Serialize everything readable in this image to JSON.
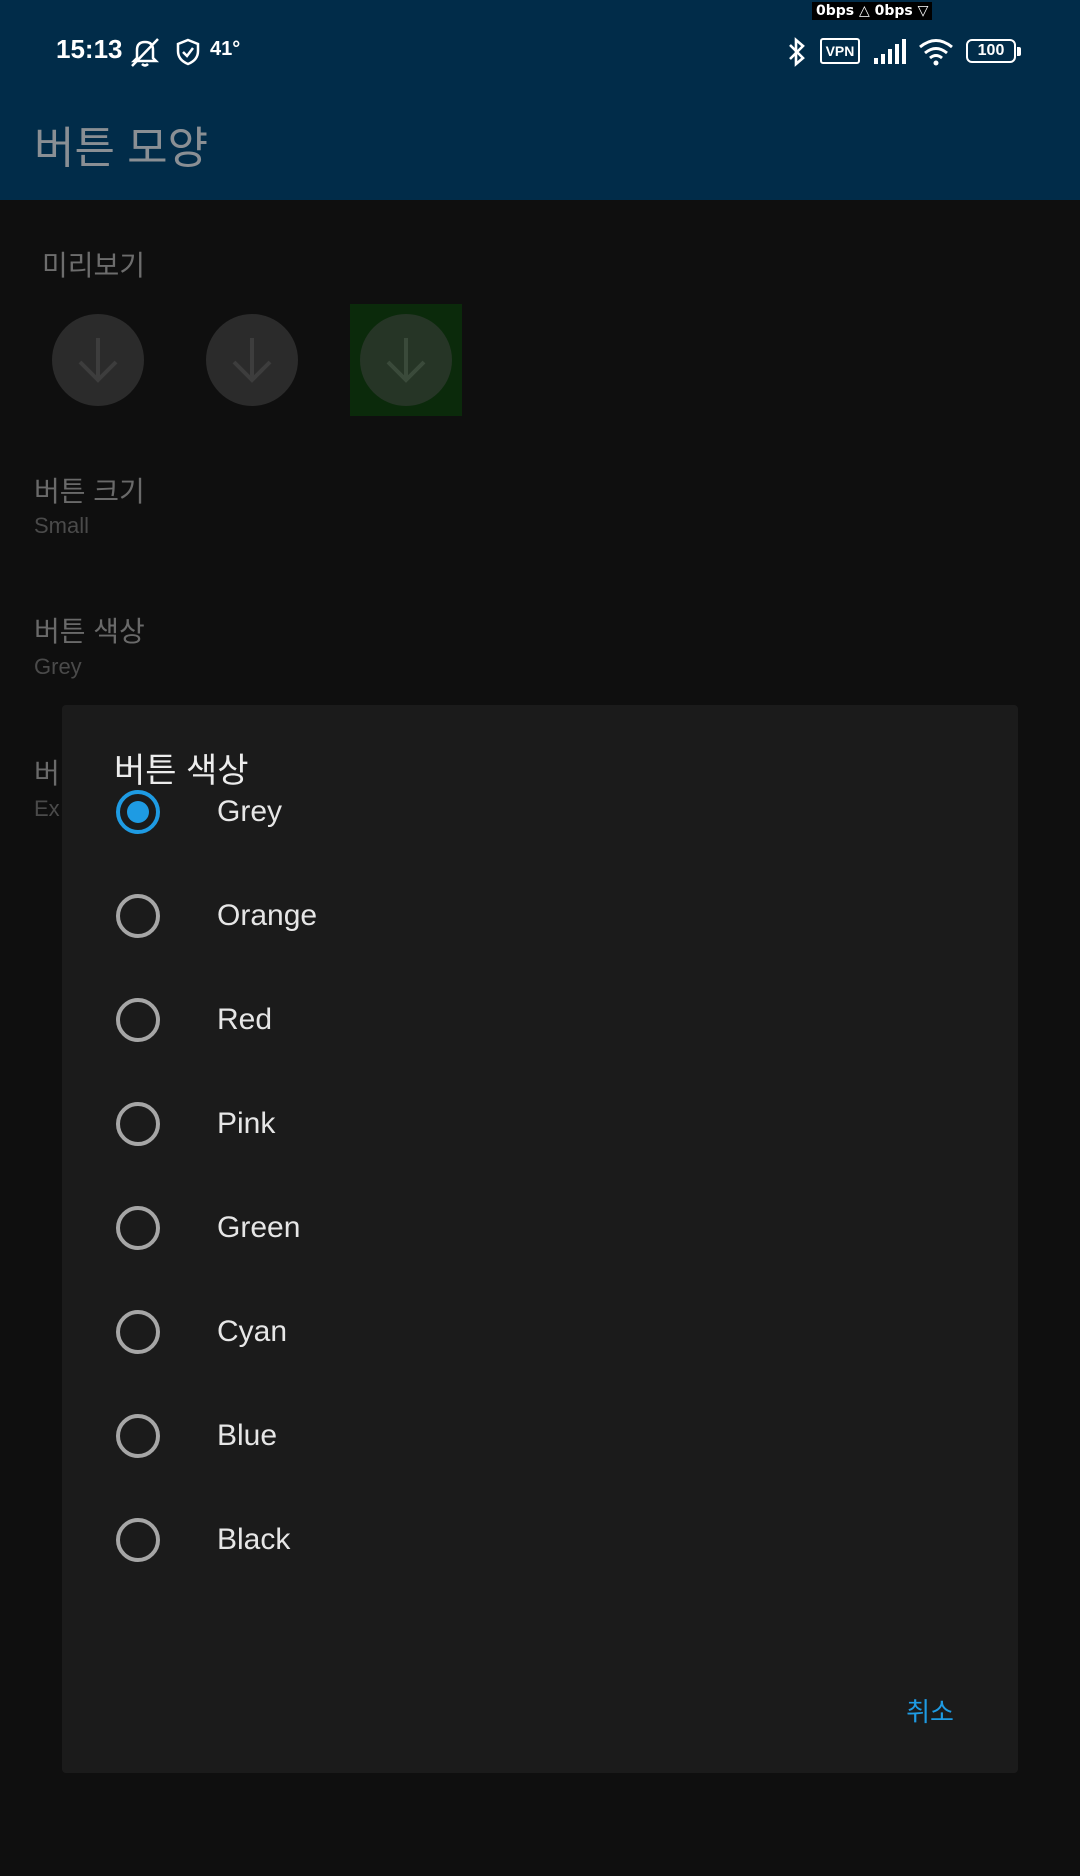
{
  "status_bar": {
    "net_speed": "0bps △ 0bps ▽",
    "time": "15:13",
    "temperature": "41°",
    "vpn_label": "VPN",
    "battery": "100"
  },
  "app_bar": {
    "title": "버튼 모양"
  },
  "background_page": {
    "preview_label": "미리보기",
    "preview_buttons": [
      "download-icon",
      "download-icon",
      "download-icon"
    ],
    "button_size": {
      "title": "버튼 크기",
      "summary": "Small"
    },
    "button_color": {
      "title": "버튼 색상",
      "summary": "Grey"
    },
    "third_pref": {
      "title": "버",
      "summary": "Ex"
    }
  },
  "dialog": {
    "title": "버튼 색상",
    "options": [
      {
        "label": "Grey",
        "checked": true
      },
      {
        "label": "Orange",
        "checked": false
      },
      {
        "label": "Red",
        "checked": false
      },
      {
        "label": "Pink",
        "checked": false
      },
      {
        "label": "Green",
        "checked": false
      },
      {
        "label": "Cyan",
        "checked": false
      },
      {
        "label": "Blue",
        "checked": false
      },
      {
        "label": "Black",
        "checked": false
      }
    ],
    "cancel_label": "취소"
  },
  "colors": {
    "accent": "#1e9be3",
    "app_bar": "#012c49",
    "dialog_bg": "#1b1b1b",
    "selected_preview_bg": "#0b2a0b"
  }
}
